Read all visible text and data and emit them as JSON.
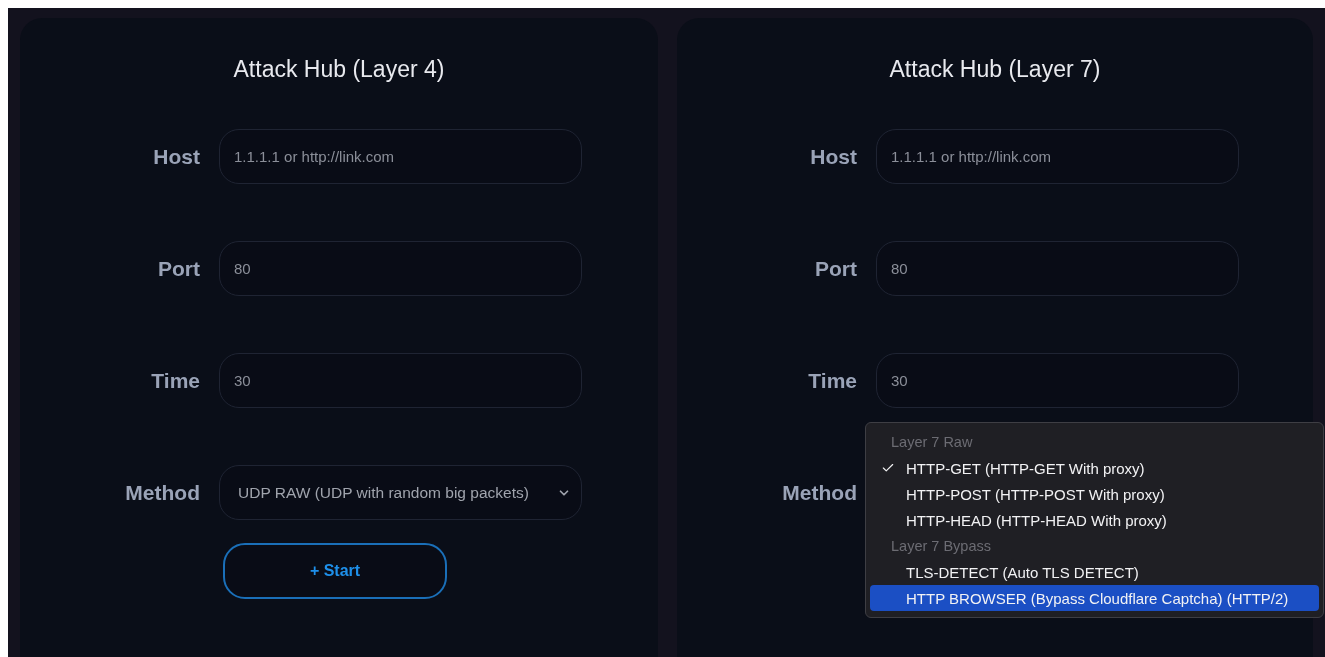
{
  "panels": [
    {
      "title": "Attack Hub (Layer 4)",
      "fields": [
        {
          "kind": "input",
          "label": "Host",
          "placeholder": "1.1.1.1 or http://link.com"
        },
        {
          "kind": "input",
          "label": "Port",
          "value": "80"
        },
        {
          "kind": "input",
          "label": "Time",
          "value": "30"
        },
        {
          "kind": "select",
          "label": "Method",
          "value": "UDP RAW (UDP with random big packets)"
        }
      ],
      "button": "+ Start"
    },
    {
      "title": "Attack Hub (Layer 7)",
      "fields": [
        {
          "kind": "input",
          "label": "Host",
          "placeholder": "1.1.1.1 or http://link.com"
        },
        {
          "kind": "input",
          "label": "Port",
          "value": "80"
        },
        {
          "kind": "input",
          "label": "Time",
          "value": "30"
        },
        {
          "kind": "menu",
          "label": "Method",
          "groups": [
            {
              "title": "Layer 7 Raw",
              "options": [
                {
                  "label": "HTTP-GET (HTTP-GET With proxy)",
                  "checked": true,
                  "highlighted": false
                },
                {
                  "label": "HTTP-POST (HTTP-POST With proxy)",
                  "checked": false,
                  "highlighted": false
                },
                {
                  "label": "HTTP-HEAD (HTTP-HEAD With proxy)",
                  "checked": false,
                  "highlighted": false
                }
              ]
            },
            {
              "title": "Layer 7 Bypass",
              "options": [
                {
                  "label": "TLS-DETECT (Auto TLS DETECT)",
                  "checked": false,
                  "highlighted": false
                },
                {
                  "label": "HTTP BROWSER (Bypass Cloudflare Captcha) (HTTP/2)",
                  "checked": false,
                  "highlighted": true
                }
              ]
            }
          ]
        }
      ]
    }
  ]
}
